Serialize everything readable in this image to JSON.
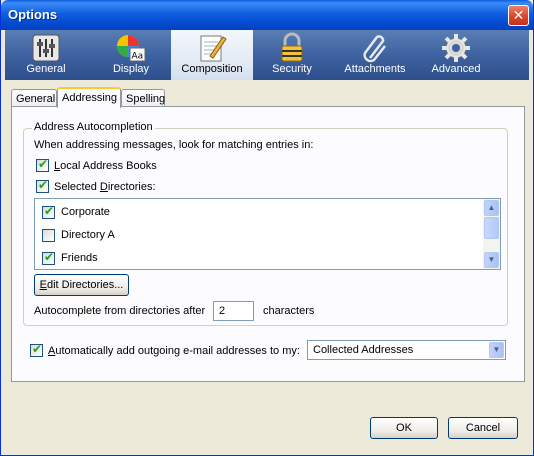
{
  "window": {
    "title": "Options",
    "close_glyph": "✕"
  },
  "panes": [
    {
      "label": "General",
      "icon": "sliders-icon"
    },
    {
      "label": "Display",
      "icon": "color-wheel-font-icon"
    },
    {
      "label": "Composition",
      "icon": "notepad-pencil-icon",
      "selected": true
    },
    {
      "label": "Security",
      "icon": "padlock-icon"
    },
    {
      "label": "Attachments",
      "icon": "paperclip-icon"
    },
    {
      "label": "Advanced",
      "icon": "gear-icon"
    }
  ],
  "tabs": [
    {
      "label": "General"
    },
    {
      "label": "Addressing",
      "active": true
    },
    {
      "label": "Spelling"
    }
  ],
  "autocomplete": {
    "group_label": "Address Autocompletion",
    "intro": "When addressing messages, look for matching entries in:",
    "local_books": {
      "label_pre": "",
      "accel": "L",
      "label_post": "ocal Address Books",
      "checked": true
    },
    "selected_dirs": {
      "label_pre": "Selected ",
      "accel": "D",
      "label_post": "irectories:",
      "checked": true
    },
    "directories": [
      {
        "label": "Corporate",
        "checked": true
      },
      {
        "label": "Directory A",
        "checked": false
      },
      {
        "label": "Friends",
        "checked": true
      }
    ],
    "edit_button": {
      "accel": "E",
      "label_post": "dit Directories..."
    },
    "after_label": "Autocomplete from directories after",
    "after_value": "2",
    "after_unit": "characters"
  },
  "auto_add": {
    "accel": "A",
    "label_post": "utomatically add outgoing e-mail addresses to my:",
    "checked": true,
    "selected": "Collected Addresses"
  },
  "buttons": {
    "ok": "OK",
    "cancel": "Cancel"
  },
  "colors": {
    "titlebar": "#0449cf",
    "toolbar": "#3e62a0",
    "check": "#21a121",
    "tab_highlight": "#ffc83c"
  }
}
